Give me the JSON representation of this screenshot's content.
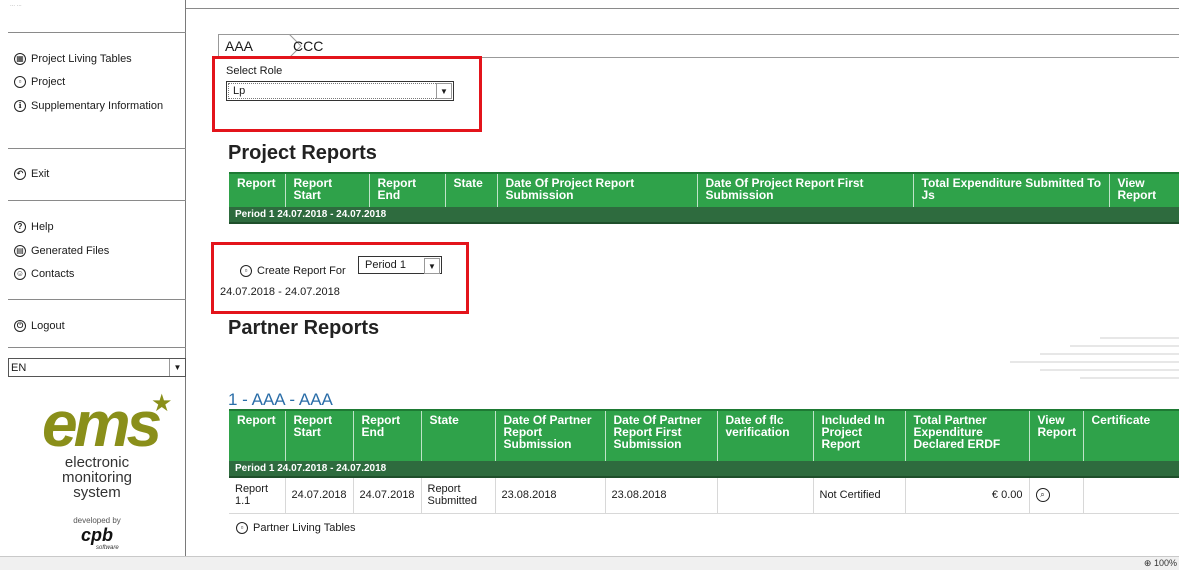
{
  "sidebar": {
    "faint_title": "... ...",
    "nav": [
      {
        "label": "Project Living Tables",
        "icon": "table-icon",
        "glyph": "▦"
      },
      {
        "label": "Project",
        "icon": "project-icon",
        "glyph": "▫"
      },
      {
        "label": "Supplementary Information",
        "icon": "info-icon",
        "glyph": "ℹ"
      }
    ],
    "exit": {
      "label": "Exit",
      "icon": "exit-icon",
      "glyph": "↶"
    },
    "help": {
      "label": "Help",
      "icon": "help-icon",
      "glyph": "?"
    },
    "generated_files": {
      "label": "Generated Files",
      "icon": "files-icon",
      "glyph": "▤"
    },
    "contacts": {
      "label": "Contacts",
      "icon": "contacts-icon",
      "glyph": "☺"
    },
    "logout": {
      "label": "Logout",
      "icon": "power-icon",
      "glyph": "⏻"
    },
    "language": "EN",
    "logo": {
      "brand": "ems",
      "line1": "electronic",
      "line2": "monitoring",
      "line3": "system",
      "developed_by": "developed by",
      "company": "cpb",
      "company_sub": "software"
    }
  },
  "breadcrumb": [
    "AAA",
    "CCC"
  ],
  "role": {
    "label": "Select Role",
    "value": "Lp"
  },
  "project_reports": {
    "title": "Project Reports",
    "columns": [
      "Report",
      "Report Start",
      "Report End",
      "State",
      "Date Of Project Report Submission",
      "Date Of Project Report First Submission",
      "Total Expenditure Submitted To Js",
      "View Report"
    ],
    "period_row": "Period 1 24.07.2018 - 24.07.2018",
    "create_label": "Create Report For",
    "create_dates": "24.07.2018 - 24.07.2018",
    "period_select": "Period 1"
  },
  "partner_reports": {
    "title": "Partner Reports",
    "section": "1 - AAA - AAA",
    "columns": [
      "Report",
      "Report Start",
      "Report End",
      "State",
      "Date Of Partner Report Submission",
      "Date Of Partner Report First Submission",
      "Date of flc verification",
      "Included In Project Report",
      "Total Partner Expenditure Declared ERDF",
      "View Report",
      "Certificate"
    ],
    "period_row": "Period 1 24.07.2018 - 24.07.2018",
    "rows": [
      {
        "report": "Report 1.1",
        "start": "24.07.2018",
        "end": "24.07.2018",
        "state": "Report Submitted",
        "submission": "23.08.2018",
        "first_submission": "23.08.2018",
        "flc": "",
        "included": "Not Certified",
        "total": "€ 0.00",
        "certificate": ""
      }
    ],
    "living_tables": "Partner Living Tables"
  },
  "status": {
    "zoom": "100%"
  },
  "colors": {
    "header_green": "#2fa24a",
    "period_green": "#2e6b3e",
    "highlight_red": "#e3141b",
    "link_blue": "#2b6ea8",
    "logo_olive": "#8a8f1a"
  }
}
